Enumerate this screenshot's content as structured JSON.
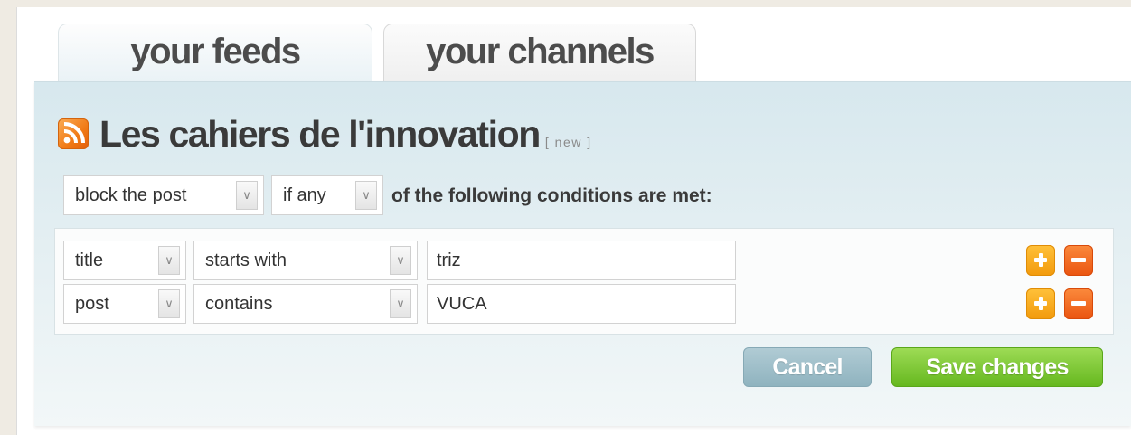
{
  "tabs": [
    {
      "label": "your feeds",
      "active": true
    },
    {
      "label": "your channels",
      "active": false
    }
  ],
  "feed": {
    "icon": "rss-icon",
    "title": "Les cahiers de l'innovation",
    "new_tag": "[ new ]"
  },
  "filter": {
    "action": {
      "value": "block the post"
    },
    "match": {
      "value": "if any"
    },
    "condition_text": "of the following conditions are met:"
  },
  "rules": [
    {
      "field": "title",
      "operator": "starts with",
      "value": "triz"
    },
    {
      "field": "post",
      "operator": "contains",
      "value": "VUCA"
    }
  ],
  "buttons": {
    "cancel": "Cancel",
    "save": "Save changes"
  },
  "colors": {
    "panel": "#d7e8ee",
    "save": "#66b81f",
    "cancel": "#8fb3bf",
    "add": "#f29a0c",
    "remove": "#ea5410"
  }
}
